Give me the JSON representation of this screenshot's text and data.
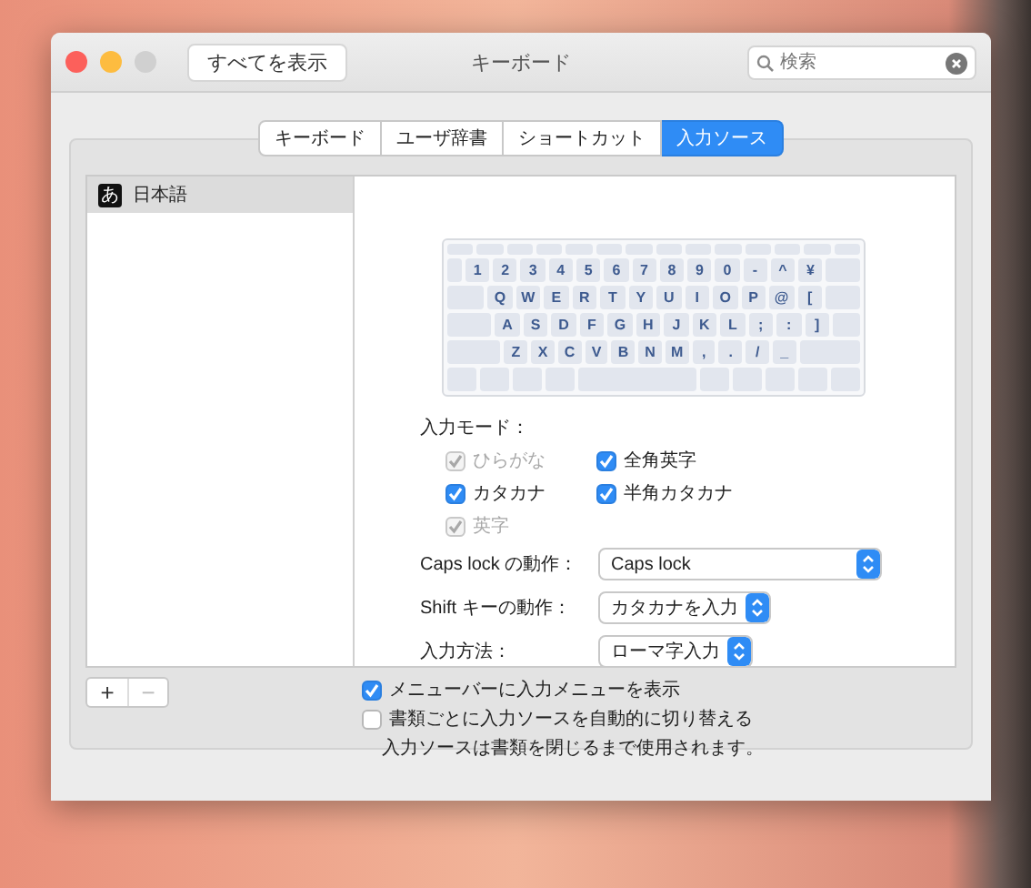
{
  "window": {
    "title": "キーボード",
    "show_all_button": "すべてを表示",
    "search": {
      "placeholder": "検索"
    }
  },
  "tabs": [
    {
      "label": "キーボード",
      "selected": false
    },
    {
      "label": "ユーザ辞書",
      "selected": false
    },
    {
      "label": "ショートカット",
      "selected": false
    },
    {
      "label": "入力ソース",
      "selected": true
    }
  ],
  "sidebar": {
    "items": [
      {
        "icon_char": "あ",
        "label": "日本語",
        "selected": true
      }
    ]
  },
  "keyboard": {
    "rows": [
      {
        "keys": [
          "1",
          "2",
          "3",
          "4",
          "5",
          "6",
          "7",
          "8",
          "9",
          "0",
          "-",
          "^",
          "¥"
        ]
      },
      {
        "keys": [
          "Q",
          "W",
          "E",
          "R",
          "T",
          "Y",
          "U",
          "I",
          "O",
          "P",
          "@",
          "["
        ]
      },
      {
        "keys": [
          "A",
          "S",
          "D",
          "F",
          "G",
          "H",
          "J",
          "K",
          "L",
          ";",
          ":",
          "]"
        ]
      },
      {
        "keys": [
          "Z",
          "X",
          "C",
          "V",
          "B",
          "N",
          "M",
          ",",
          ".",
          "/",
          "_"
        ]
      }
    ]
  },
  "input_mode": {
    "label": "入力モード：",
    "options": [
      {
        "label": "ひらがな",
        "checked": true,
        "disabled": true
      },
      {
        "label": "全角英字",
        "checked": true,
        "disabled": false
      },
      {
        "label": "カタカナ",
        "checked": true,
        "disabled": false
      },
      {
        "label": "半角カタカナ",
        "checked": true,
        "disabled": false
      },
      {
        "label": "英字",
        "checked": true,
        "disabled": true
      }
    ]
  },
  "settings": [
    {
      "label": "Caps lock の動作：",
      "value": "Caps lock"
    },
    {
      "label": "Shift キーの動作：",
      "value": "カタカナを入力"
    },
    {
      "label": "入力方法：",
      "value": "ローマ字入力"
    }
  ],
  "list_buttons": [
    {
      "label": "+",
      "disabled": false
    },
    {
      "label": "−",
      "disabled": true
    }
  ],
  "bottom_options": [
    {
      "label": "メニューバーに入力メニューを表示",
      "checked": true
    },
    {
      "label": "書類ごとに入力ソースを自動的に切り替える",
      "checked": false
    }
  ],
  "note": "入力ソースは書類を閉じるまで使用されます。"
}
